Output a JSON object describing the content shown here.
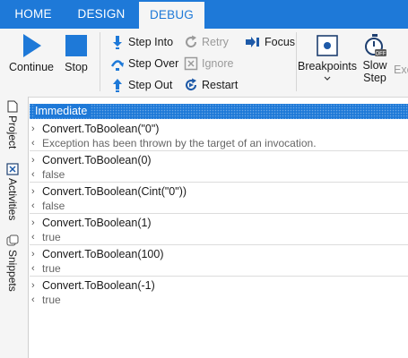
{
  "tabs": [
    {
      "label": "HOME",
      "active": false
    },
    {
      "label": "DESIGN",
      "active": false
    },
    {
      "label": "DEBUG",
      "active": true
    }
  ],
  "ribbon": {
    "continue_label": "Continue",
    "stop_label": "Stop",
    "step_into_label": "Step Into",
    "step_over_label": "Step Over",
    "step_out_label": "Step Out",
    "retry_label": "Retry",
    "ignore_label": "Ignore",
    "restart_label": "Restart",
    "focus_label": "Focus",
    "breakpoints_label": "Breakpoints",
    "slow_step_label_1": "Slow",
    "slow_step_label_2": "Step",
    "slow_step_badge": "OFF",
    "exec_label": "Exe"
  },
  "sidebar": {
    "project_label": "Project",
    "activities_label": "Activities",
    "snippets_label": "Snippets"
  },
  "panel": {
    "title": "Immediate",
    "entries": [
      {
        "command": "Convert.ToBoolean(\"0\")",
        "result": "Exception has been thrown by the target of an invocation."
      },
      {
        "command": "Convert.ToBoolean(0)",
        "result": "false"
      },
      {
        "command": "Convert.ToBoolean(Cint(\"0\"))",
        "result": "false"
      },
      {
        "command": "Convert.ToBoolean(1)",
        "result": "true"
      },
      {
        "command": "Convert.ToBoolean(100)",
        "result": "true"
      },
      {
        "command": "Convert.ToBoolean(-1)",
        "result": "true"
      }
    ]
  },
  "colors": {
    "accent": "#1e79d8",
    "ribbon_bg": "#f5f5f5",
    "disabled": "#9a9a9a"
  }
}
